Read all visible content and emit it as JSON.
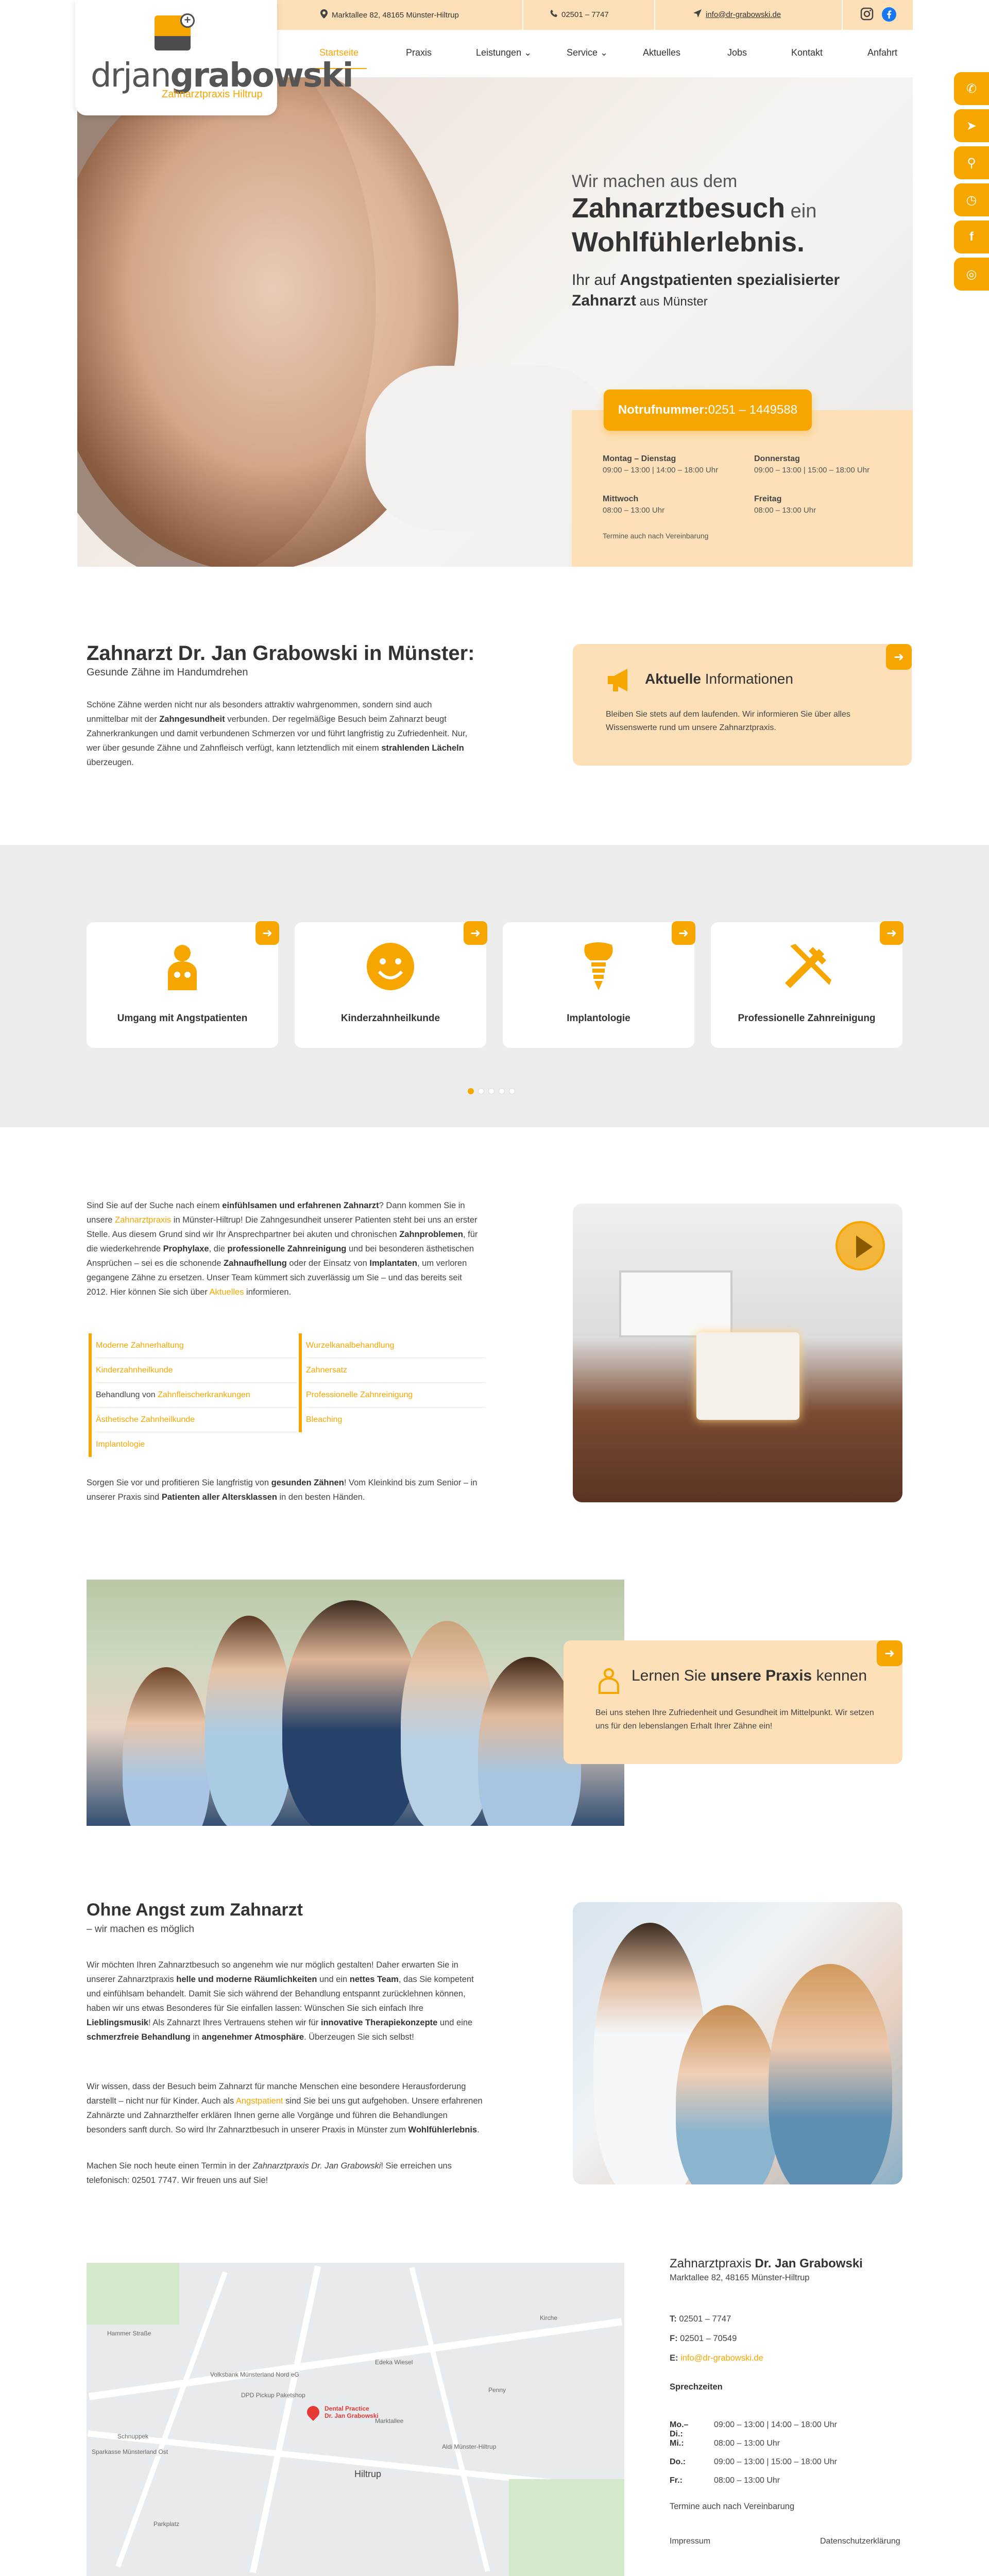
{
  "topbar": {
    "address": "Marktallee 82, 48165 Münster-Hiltrup",
    "phone": "02501 – 7747",
    "email": "info@dr-grabowski.de"
  },
  "logo": {
    "name_light": "drjan",
    "name_bold": "grabowski",
    "subtitle": "Zahnarztpraxis Hiltrup"
  },
  "nav": {
    "items": [
      {
        "label": "Startseite"
      },
      {
        "label": "Praxis"
      },
      {
        "label": "Leistungen ⌄"
      },
      {
        "label": "Service ⌄"
      },
      {
        "label": "Aktuelles"
      },
      {
        "label": "Jobs"
      },
      {
        "label": "Kontakt"
      },
      {
        "label": "Anfahrt"
      }
    ]
  },
  "side_tabs": [
    "phone-icon",
    "send-icon",
    "location-icon",
    "clock-icon",
    "facebook-icon",
    "instagram-icon"
  ],
  "hero": {
    "line1": "Wir machen aus dem",
    "line2_bold": "Zahnarztbesuch",
    "line2_light": " ein",
    "line3_bold": "Wohlfühlerlebnis.",
    "sub_pre": "Ihr auf ",
    "sub_bold1": "Angstpatienten spezialisierter",
    "sub_bold2": "Zahnarzt",
    "sub_post": " aus Münster",
    "notruf_label": "Notrufnummer:",
    "notruf_value": " 0251 – 1449588"
  },
  "hours": {
    "mo_di_label": "Montag – Dienstag",
    "mo_di": "09:00 – 13:00 | 14:00 – 18:00 Uhr",
    "do_label": "Donnerstag",
    "do": "09:00 – 13:00 | 15:00 – 18:00 Uhr",
    "mi_label": "Mittwoch",
    "mi": "08:00 – 13:00 Uhr",
    "fr_label": "Freitag",
    "fr": "08:00 – 13:00 Uhr",
    "note": "Termine auch nach Vereinbarung"
  },
  "intro": {
    "title_bold": "Zahnarzt Dr. Jan Grabowski",
    "title_light": " in Münster:",
    "subtitle": "Gesunde Zähne im Handumdrehen",
    "p_a": "Schöne Zähne werden nicht nur als besonders attraktiv wahrgenommen, sondern sind auch unmittelbar mit der ",
    "p_b": "Zahngesundheit",
    "p_c": " verbunden. Der regelmäßige Besuch beim Zahnarzt beugt Zahnerkrankungen und damit verbundenen Schmerzen vor und führt langfristig zu Zufriedenheit. Nur, wer über gesunde Zähne und Zahnfleisch verfügt, kann letztendlich mit einem ",
    "p_d": "strahlenden Lächeln",
    "p_e": " überzeugen."
  },
  "news": {
    "title_bold": "Aktuelle",
    "title_light": " Informationen",
    "text": "Bleiben Sie stets auf dem laufenden. Wir informieren Sie über alles Wissenswerte rund um unsere Zahnarztpraxis."
  },
  "services": [
    {
      "label": "Umgang mit Angstpatienten",
      "icon": "anxious-person-icon"
    },
    {
      "label": "Kinderzahnheilkunde",
      "icon": "smiley-icon"
    },
    {
      "label": "Implantologie",
      "icon": "implant-icon"
    },
    {
      "label": "Professionelle Zahnreinigung",
      "icon": "toothbrush-toothpaste-icon"
    }
  ],
  "about": {
    "p1_a": "Sind Sie auf der Suche nach einem ",
    "p1_b": "einfühlsamen und erfahrenen Zahnarzt",
    "p1_c": "? Dann kommen Sie in unsere ",
    "p1_link": "Zahnarztpraxis",
    "p1_d": " in Münster-Hiltrup! Die Zahngesundheit unserer Patienten steht bei uns an erster Stelle. Aus diesem Grund sind wir Ihr Ansprechpartner bei akuten und chronischen ",
    "p1_e": "Zahnproblemen",
    "p1_f": ", für die wiederkehrende ",
    "p1_g": "Prophylaxe",
    "p1_h": ", die ",
    "p1_i": "professionelle Zahnreinigung",
    "p1_j": " und bei besonderen ästhetischen Ansprüchen – sei es die schonende ",
    "p1_k": "Zahnaufhellung",
    "p1_l": " oder der Einsatz von ",
    "p1_m": "Implantaten",
    "p1_n": ", um verloren gegangene Zähne zu ersetzen. Unser Team kümmert sich zuverlässig um Sie – und das bereits seit 2012. Hier können Sie sich über ",
    "p1_link2": "Aktuelles",
    "p1_o": " informieren.",
    "list_left": [
      {
        "pre": "",
        "link": "Moderne Zahnerhaltung"
      },
      {
        "pre": "",
        "link": "Kinderzahnheilkunde"
      },
      {
        "pre": "Behandlung von ",
        "link": "Zahnfleischerkrankungen"
      },
      {
        "pre": "",
        "link": "Ästhetische Zahnheilkunde"
      },
      {
        "pre": "",
        "link": "Implantologie"
      }
    ],
    "list_right": [
      {
        "link": "Wurzelkanalbehandlung"
      },
      {
        "link": "Zahnersatz"
      },
      {
        "link": "Professionelle Zahnreinigung"
      },
      {
        "link": "Bleaching"
      }
    ],
    "p2_a": "Sorgen Sie vor und profitieren Sie langfristig von ",
    "p2_b": "gesunden Zähnen",
    "p2_c": "! Vom Kleinkind bis zum Senior – in unserer Praxis sind ",
    "p2_d": "Patienten aller Altersklassen",
    "p2_e": " in den besten Händen."
  },
  "praxis_box": {
    "title_light": "Lernen Sie ",
    "title_bold": "unsere Praxis",
    "title_end": " kennen",
    "text": "Bei uns stehen Ihre Zufriedenheit und Gesundheit im Mittelpunkt. Wir setzen uns für den lebenslangen Erhalt Ihrer Zähne ein!"
  },
  "angst": {
    "title_bold": "Ohne Angst",
    "title_light": " zum Zahnarzt",
    "subtitle": "– wir machen es möglich",
    "p1_a": "Wir möchten Ihren Zahnarztbesuch so angenehm wie nur möglich gestalten! Daher erwarten Sie in unserer Zahnarztpraxis ",
    "p1_b": "helle und moderne Räumlichkeiten",
    "p1_c": " und ein ",
    "p1_d": "nettes Team",
    "p1_e": ", das Sie kompetent und einfühlsam behandelt. Damit Sie sich während der Behandlung entspannt zurücklehnen können, haben wir uns etwas Besonderes für Sie einfallen lassen: Wünschen Sie sich einfach Ihre ",
    "p1_f": "Lieblingsmusik",
    "p1_g": "! Als Zahnarzt Ihres Vertrauens stehen wir für ",
    "p1_h": "innovative Therapiekonzepte",
    "p1_i": " und eine ",
    "p1_j": "schmerzfreie Behandlung",
    "p1_k": " in ",
    "p1_l": "angenehmer Atmosphäre",
    "p1_m": ". Überzeugen Sie sich selbst!",
    "p2_a": "Wir wissen, dass der Besuch beim Zahnarzt für manche Menschen eine besondere Herausforderung darstellt – nicht nur für Kinder. Auch als ",
    "p2_link": "Angstpatient",
    "p2_b": " sind Sie bei uns gut aufgehoben. Unsere erfahrenen Zahnärzte und Zahnarzthelfer erklären Ihnen gerne alle Vorgänge und führen die Behandlungen besonders sanft durch. So wird Ihr Zahnarztbesuch in unserer Praxis in Münster zum ",
    "p2_c": "Wohlfühlerlebnis",
    "p2_d": ".",
    "p3_a": "Machen Sie noch heute einen Termin in der ",
    "p3_b": "Zahnarztpraxis Dr. Jan Grabowski",
    "p3_c": "! Sie erreichen uns telefonisch: 02501 7747. Wir freuen uns auf Sie!"
  },
  "map": {
    "pin_label1": "Dental Practice",
    "pin_label2": "Dr. Jan Grabowski",
    "labels": [
      "Volksbank Münsterland Nord eG",
      "DPD Pickup Paketshop",
      "Edeka Wiesel",
      "Penny",
      "Schnuppek",
      "Sparkasse Münsterland Ost",
      "Hiltrup",
      "Aldi Münster-Hiltrup",
      "Hammer Straße",
      "Marktallee",
      "Parkplatz",
      "Kirche"
    ]
  },
  "contact": {
    "title_light": "Zahnarztpraxis ",
    "title_mid": "Dr. Jan",
    "title_bold": " Grabowski",
    "address": "Marktallee 82, 48165 Münster-Hiltrup",
    "t_label": "T:",
    "t": " 02501 – 7747",
    "f_label": "F:",
    "f": " 02501 – 70549",
    "e_label": "E:",
    "e": " info@dr-grabowski.de",
    "hours_title": "Sprechzeiten",
    "hours": [
      {
        "day": "Mo.– Di.:",
        "time": "09:00 – 13:00 | 14:00 – 18:00 Uhr"
      },
      {
        "day": "Mi.:",
        "time": "08:00 – 13:00 Uhr"
      },
      {
        "day": "Do.:",
        "time": "09:00 – 13:00 | 15:00 – 18:00 Uhr"
      },
      {
        "day": "Fr.:",
        "time": "08:00 – 13:00 Uhr"
      }
    ],
    "note": "Termine auch nach Vereinbarung",
    "impressum": "Impressum",
    "datenschutz": "Datenschutzerklärung"
  },
  "colors": {
    "accent": "#f7a600",
    "accent_light": "#fde0b8",
    "band": "#ececec"
  }
}
